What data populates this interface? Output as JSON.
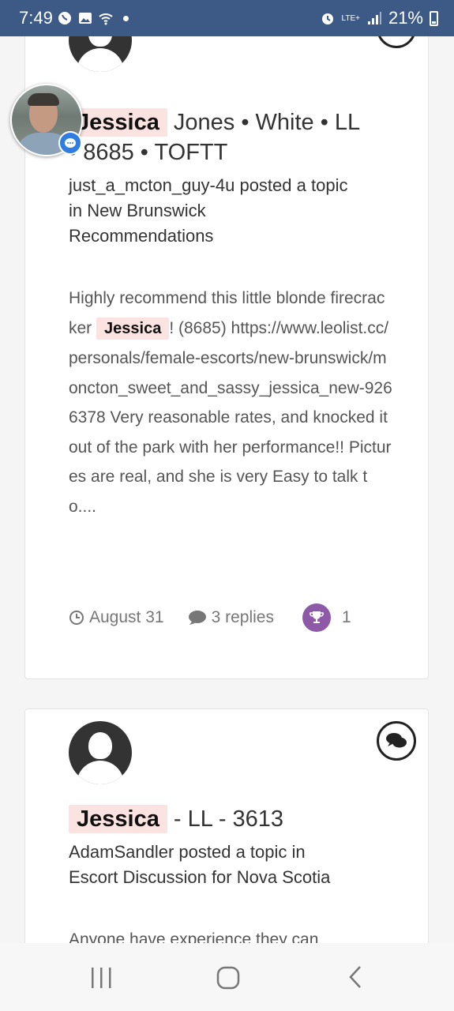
{
  "status_bar": {
    "time": "7:49",
    "lte": "LTE+",
    "battery": "21%"
  },
  "posts": [
    {
      "title_highlight": "Jessica",
      "title_line1_rest": " Jones • White • LL",
      "title_line2": "• 8685 • TOFTT",
      "meta_line1": "just_a_mcton_guy-4u posted a topic",
      "meta_line2": "in New Brunswick",
      "meta_line3": "Recommendations",
      "body_pre": "Highly recommend this little blonde firecracker ",
      "body_highlight": "Jessica",
      "body_post": "! (8685) https://www.leolist.cc/personals/female-escorts/new-brunswick/moncton_sweet_and_sassy_jessica_new-9266378 Very reasonable rates, and knocked it out of the park with her performance!! Pictures are real, and she is very Easy to talk to....",
      "date": "August 31",
      "replies": "3 replies",
      "reactions": "1"
    },
    {
      "title_highlight": "Jessica",
      "title_rest": " - LL - 3613",
      "meta_line1": "AdamSandler posted a topic in",
      "meta_line2": "Escort Discussion for Nova Scotia",
      "body_preview": "Anyone have experience they can"
    }
  ],
  "colors": {
    "status_bar": "#3d5a87",
    "highlight": "#fbe3e1",
    "trophy": "#8e5aa8",
    "chat_badge": "#2f7de1"
  },
  "icons": [
    "clock-icon",
    "comment-icon",
    "trophy-icon",
    "chat-bubbles-icon",
    "messenger-icon",
    "recents-icon",
    "home-icon",
    "back-icon"
  ]
}
